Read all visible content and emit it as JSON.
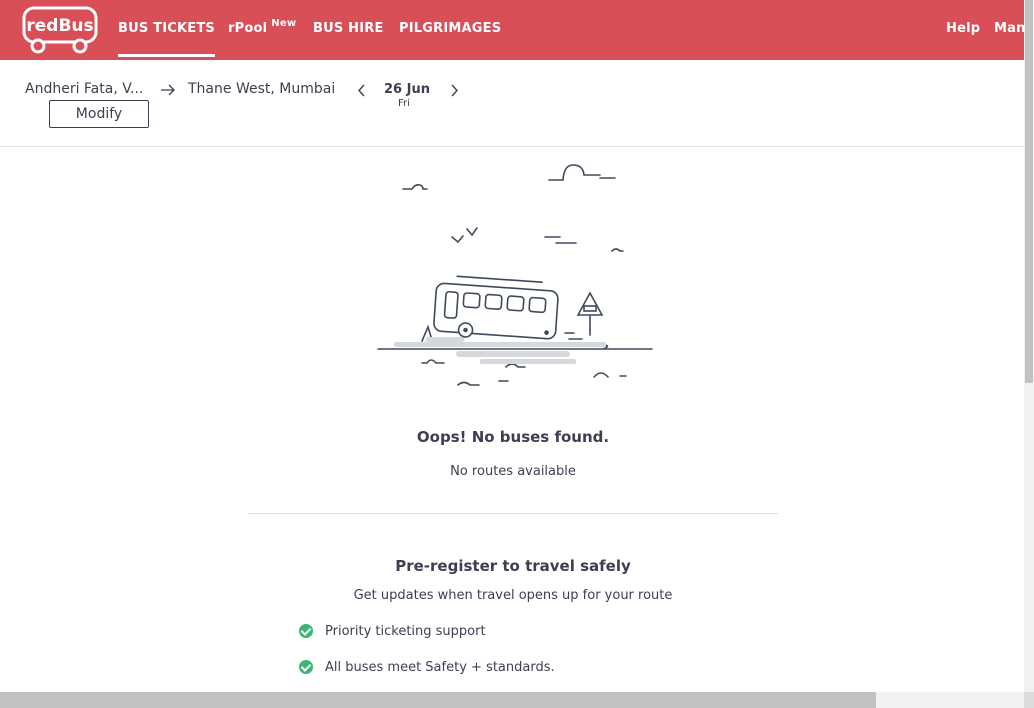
{
  "header": {
    "logo_text": "redBus",
    "nav": [
      {
        "label": "BUS TICKETS",
        "active": true
      },
      {
        "label": "rPool",
        "badge": "New"
      },
      {
        "label": "BUS HIRE"
      },
      {
        "label": "PILGRIMAGES"
      }
    ],
    "help_label": "Help",
    "manage_label": "Mana"
  },
  "search": {
    "from": "Andheri Fata, V...",
    "to": "Thane West, Mumbai",
    "date": "26 Jun",
    "day": "Fri",
    "modify_label": "Modify"
  },
  "empty_state": {
    "title": "Oops! No buses found.",
    "subtitle": "No routes available"
  },
  "preregister": {
    "title": "Pre-register to travel safely",
    "subtitle": "Get updates when travel opens up for your route",
    "benefits": [
      "Priority ticketing support",
      "All buses meet Safety + standards."
    ]
  },
  "colors": {
    "brand": "#d84f57",
    "text": "#3e3e52",
    "check": "#3ab774"
  },
  "icons": [
    "redbus-logo-icon",
    "arrow-right-icon",
    "chevron-left-icon",
    "chevron-right-icon",
    "check-circle-icon",
    "no-bus-illustration"
  ]
}
